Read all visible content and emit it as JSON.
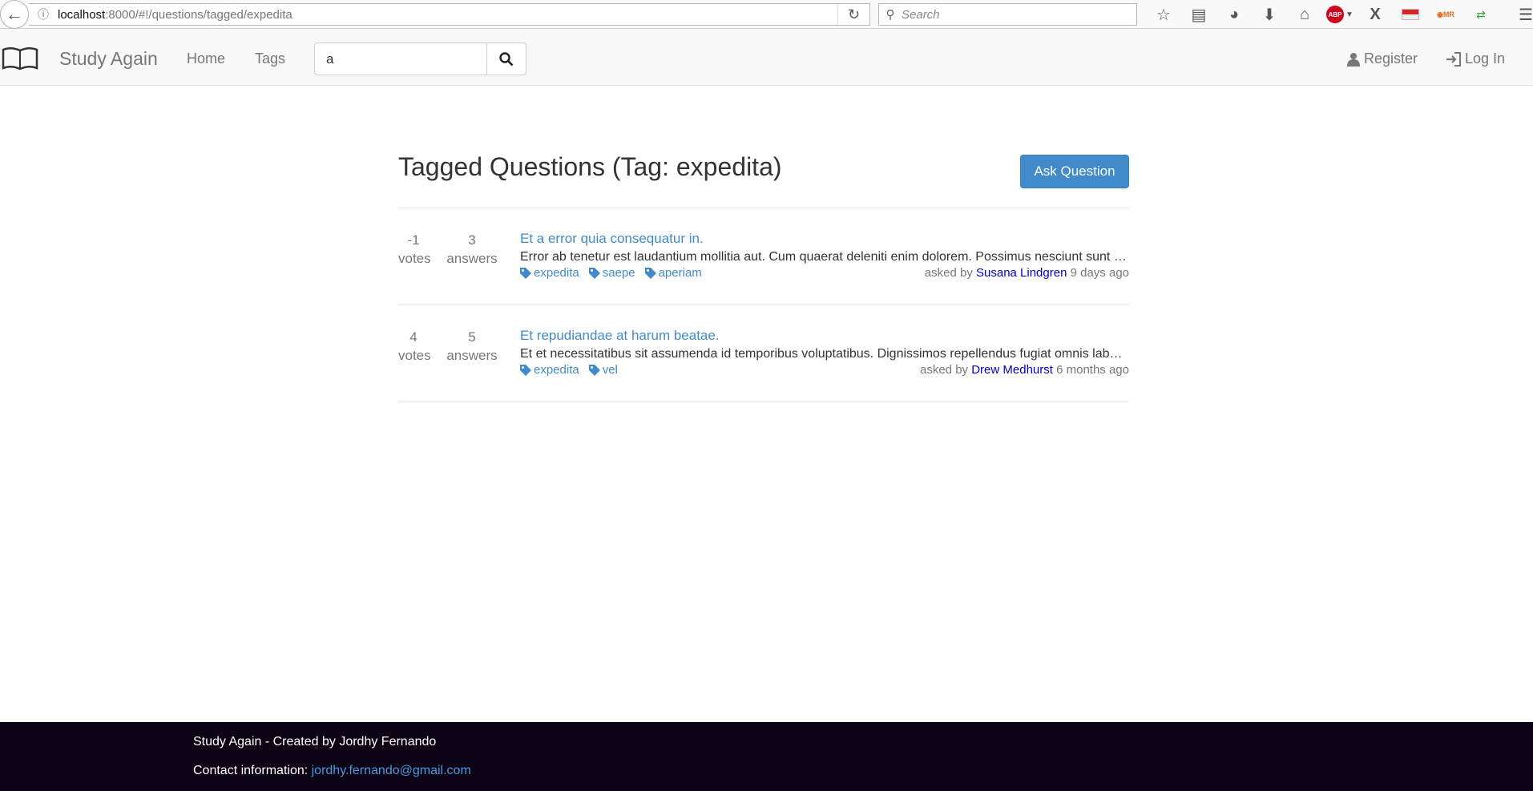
{
  "browser": {
    "url_host": "localhost",
    "url_path": ":8000/#!/questions/tagged/expedita",
    "search_placeholder": "Search"
  },
  "navbar": {
    "brand": "Study Again",
    "links": [
      "Home",
      "Tags"
    ],
    "search_value": "a",
    "register": "Register",
    "login": "Log In"
  },
  "main": {
    "title": "Tagged Questions (Tag: expedita)",
    "ask_button": "Ask Question",
    "questions": [
      {
        "votes": "-1",
        "votes_label": "votes",
        "answers": "3",
        "answers_label": "answers",
        "title": "Et a error quia consequatur in.",
        "excerpt": "Error ab tenetur est laudantium mollitia aut. Cum quaerat deleniti enim dolorem. Possimus nesciunt sunt dolores rem.",
        "tags": [
          "expedita",
          "saepe",
          "aperiam"
        ],
        "asked_by_label": "asked by",
        "author": "Susana Lindgren",
        "time": "9 days ago"
      },
      {
        "votes": "4",
        "votes_label": "votes",
        "answers": "5",
        "answers_label": "answers",
        "title": "Et repudiandae at harum beatae.",
        "excerpt": "Et et necessitatibus sit assumenda id temporibus voluptatibus. Dignissimos repellendus fugiat omnis labore.",
        "tags": [
          "expedita",
          "vel"
        ],
        "asked_by_label": "asked by",
        "author": "Drew Medhurst",
        "time": "6 months ago"
      }
    ]
  },
  "footer": {
    "credit": "Study Again - Created by Jordhy Fernando",
    "contact_label": "Contact information: ",
    "email": "jordhy.fernando@gmail.com"
  },
  "colors": {
    "primary": "#428bca",
    "footer_bg": "#0c0314",
    "author_link": "#0000cc"
  }
}
